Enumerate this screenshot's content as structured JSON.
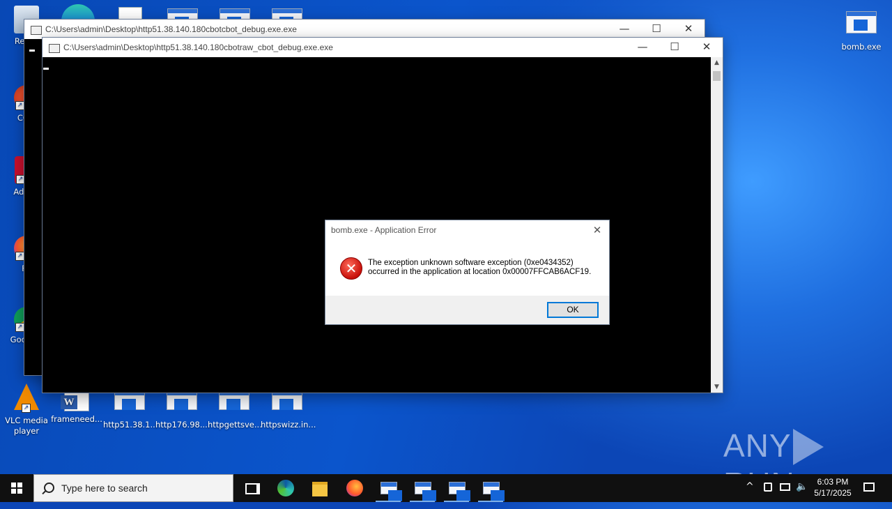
{
  "desktop": {
    "icons_left": [
      {
        "label": "Recycle Bin",
        "visible": "RecyF"
      },
      {
        "label": "CCleaner",
        "visible": "CCle"
      },
      {
        "label": "Adobe Acrobat",
        "visible": "Ad Acr"
      },
      {
        "label": "Firefox",
        "visible": "Fir"
      },
      {
        "label": "Google Chrome",
        "visible": "Goo Chr"
      }
    ],
    "icons_bottom": [
      {
        "label": "VLC media player"
      },
      {
        "label": "frameneed..."
      },
      {
        "label": "http51.38.1..."
      },
      {
        "label": "http176.98...."
      },
      {
        "label": "httpgettsve..."
      },
      {
        "label": "httpswizz.in..."
      }
    ],
    "icon_right": {
      "label": "bomb.exe"
    }
  },
  "windows": {
    "back": {
      "title": "C:\\Users\\admin\\Desktop\\http51.38.140.180cbotcbot_debug.exe.exe"
    },
    "front": {
      "title": "C:\\Users\\admin\\Desktop\\http51.38.140.180cbotraw_cbot_debug.exe.exe"
    }
  },
  "dialog": {
    "title": "bomb.exe - Application Error",
    "message_line1": "The exception unknown software exception (0xe0434352)",
    "message_line2": "occurred in the application at location 0x00007FFCAB6ACF19.",
    "ok_label": "OK"
  },
  "taskbar": {
    "search_placeholder": "Type here to search",
    "time": "6:03 PM",
    "date": "5/17/2025"
  },
  "watermark": {
    "left": "ANY",
    "right": "RUN"
  }
}
